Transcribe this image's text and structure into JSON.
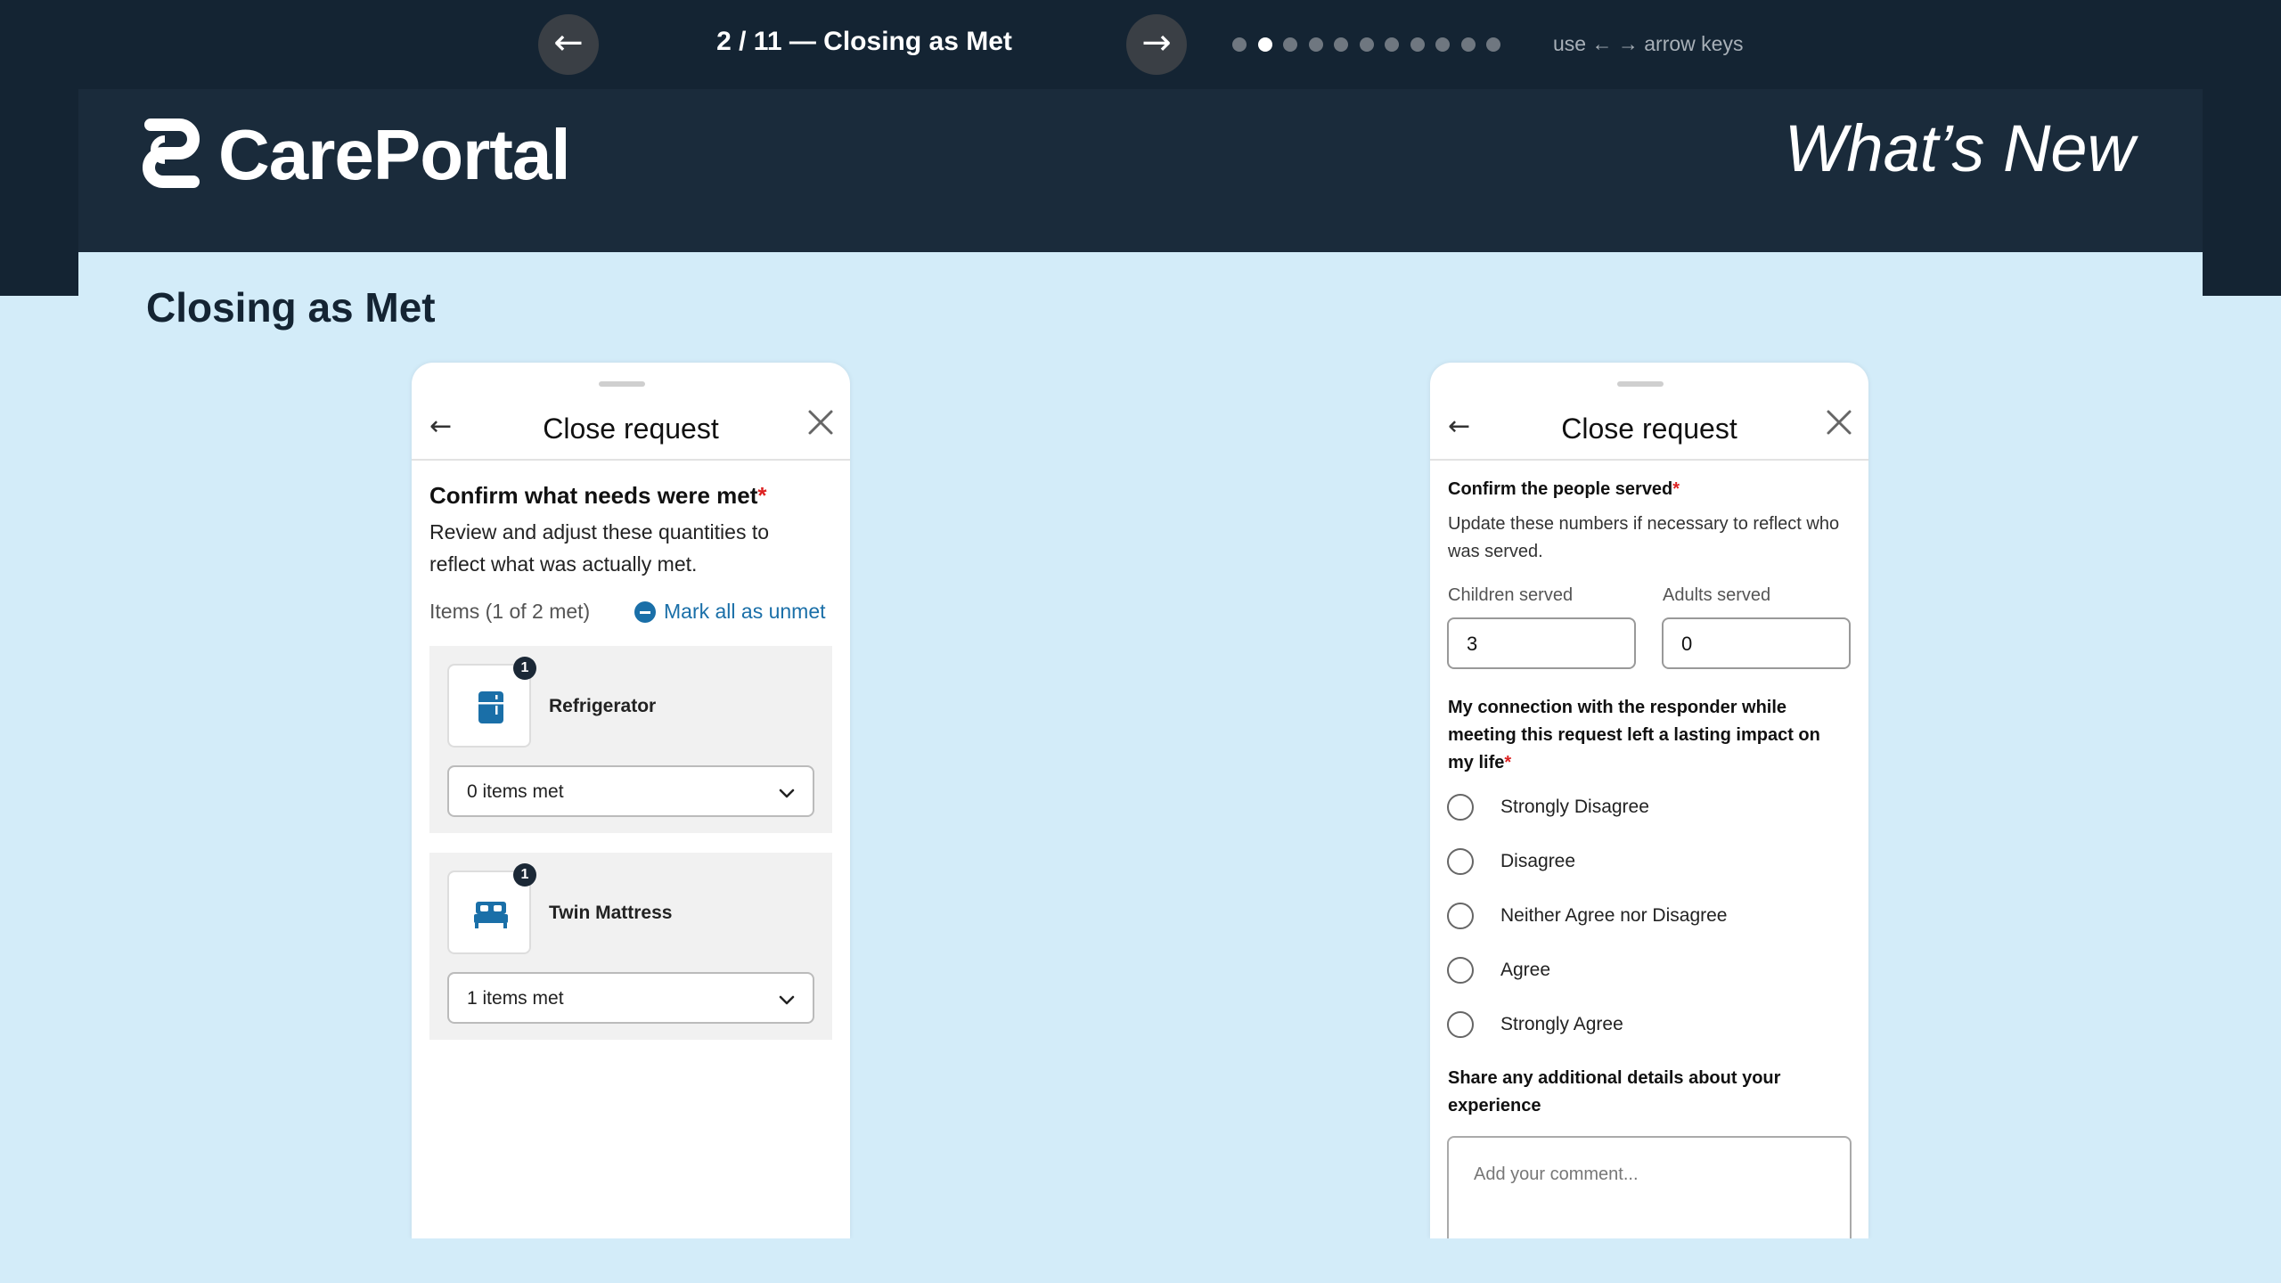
{
  "nav": {
    "prev": "←",
    "next": "→",
    "title": "2 / 11 — Closing as Met",
    "hint": "use ← → arrow keys",
    "dots_total": 11,
    "dots_active": 2
  },
  "header": {
    "brand": "CarePortal",
    "tagline": "What’s New"
  },
  "page": {
    "title": "Closing as Met"
  },
  "left_phone": {
    "title": "Close request",
    "heading": "Confirm what needs were met",
    "required_mark": "*",
    "description": "Review and adjust these quantities to reflect what was actually met.",
    "items_summary": "Items (1 of 2 met)",
    "mark_all_label": "Mark all as unmet",
    "items": [
      {
        "name": "Refrigerator",
        "badge": "1",
        "icon": "refrigerator-icon",
        "selected": "0 items met"
      },
      {
        "name": "Twin Mattress",
        "badge": "1",
        "icon": "bed-icon",
        "selected": "1 items met"
      }
    ]
  },
  "right_phone": {
    "title": "Close request",
    "people_heading": "Confirm the people served",
    "required_mark": "*",
    "people_description": "Update these numbers if necessary to reflect who was served.",
    "children_label": "Children served",
    "children_value": "3",
    "adults_label": "Adults served",
    "adults_value": "0",
    "impact_question": "My connection with the responder while meeting this request left a lasting impact on my life",
    "options": [
      "Strongly Disagree",
      "Disagree",
      "Neither Agree nor Disagree",
      "Agree",
      "Strongly Agree"
    ],
    "details_heading": "Share any additional details about your experience",
    "comment_placeholder": "Add your comment..."
  },
  "colors": {
    "dark_navy": "#142433",
    "band": "#1a2b3b",
    "light_blue": "#d3ecf9",
    "accent": "#1a6fa8",
    "required": "#dd2222"
  }
}
